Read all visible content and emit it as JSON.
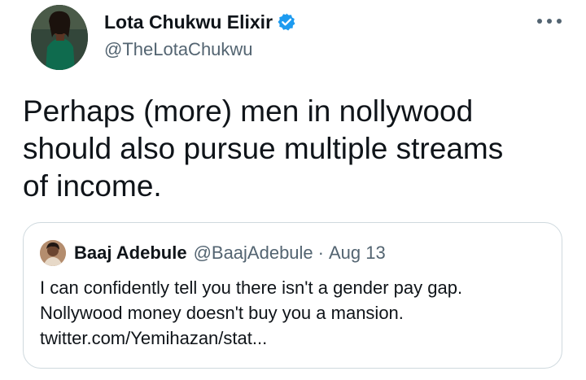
{
  "author": {
    "display_name": "Lota Chukwu Elixir",
    "handle": "@TheLotaChukwu",
    "verified": true
  },
  "tweet": {
    "lines": [
      "Perhaps (more) men in nollywood",
      "should also pursue multiple streams",
      "of income."
    ]
  },
  "quoted": {
    "display_name": "Baaj Adebule",
    "handle": "@BaajAdebule",
    "separator": "·",
    "date": "Aug 13",
    "lines": [
      "I can confidently tell you there isn't a gender pay gap.",
      "Nollywood money doesn't buy you a mansion.",
      "twitter.com/Yemihazan/stat..."
    ]
  },
  "colors": {
    "verified": "#1d9bf0",
    "secondary_text": "#536471",
    "border": "#cfd9de"
  },
  "icons": [
    "verified-badge-icon",
    "more-options-icon"
  ]
}
